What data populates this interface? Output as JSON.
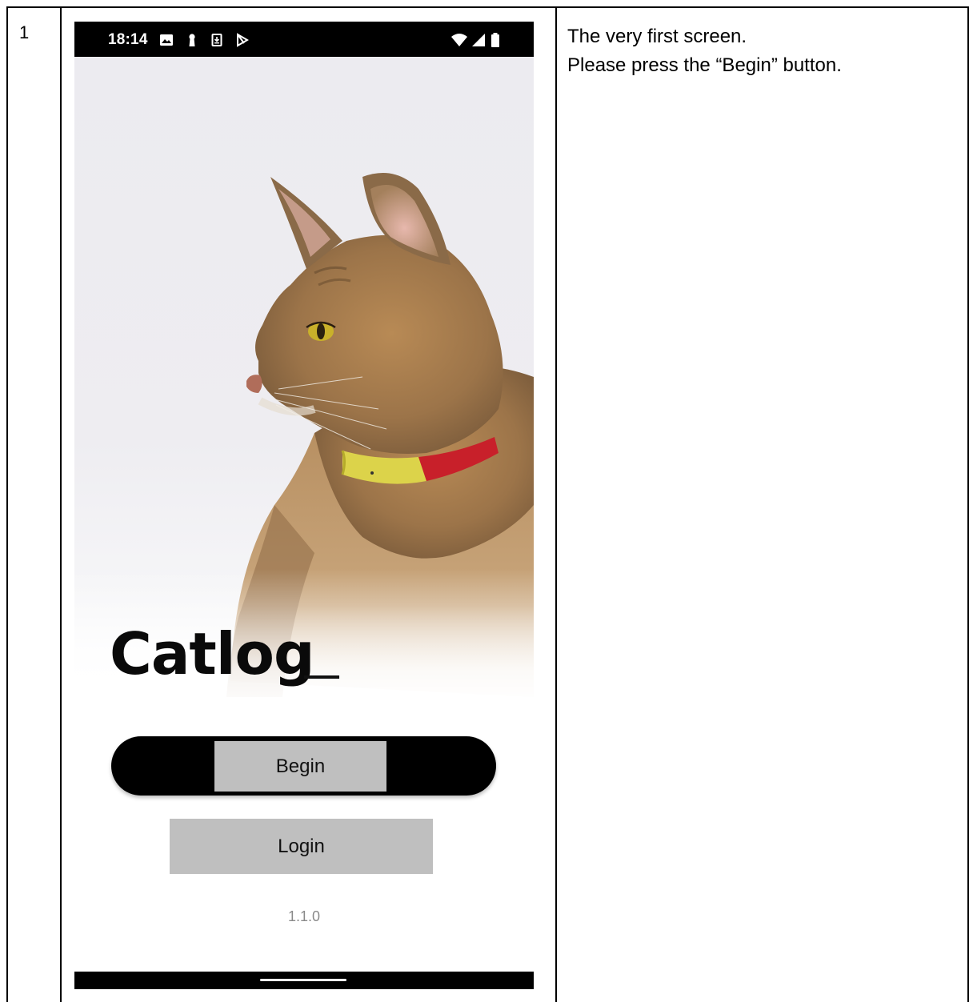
{
  "row": {
    "number": "1"
  },
  "instructions": {
    "line1": "The very first screen.",
    "line2": "Please press the “Begin” button."
  },
  "status_bar": {
    "time": "18:14",
    "left_icons": [
      "image-icon",
      "keyhole-icon",
      "download-icon",
      "play-store-icon"
    ],
    "right_icons": [
      "wifi-icon",
      "signal-icon",
      "battery-icon"
    ]
  },
  "app": {
    "logo": "Catlog",
    "begin_label": "Begin",
    "login_label": "Login",
    "version": "1.1.0"
  },
  "colors": {
    "button_fill": "#bfbfbf",
    "pill": "#000000",
    "collar_yellow": "#d9d23a",
    "collar_red": "#c8202a"
  }
}
